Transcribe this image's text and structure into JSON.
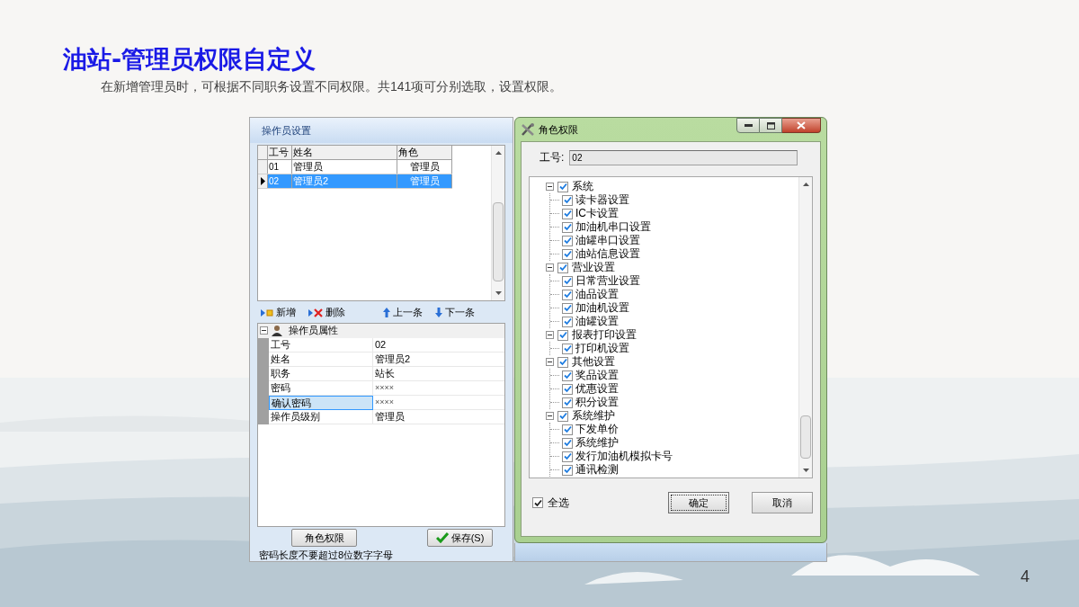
{
  "slide": {
    "title": "油站-管理员权限自定义",
    "subtitle": "在新增管理员时，可根据不同职务设置不同权限。共141项可分别选取，设置权限。",
    "page_number": "4"
  },
  "operator_window": {
    "title": "操作员设置",
    "grid": {
      "columns": [
        "工号",
        "姓名",
        "角色"
      ],
      "rows": [
        {
          "cells": [
            "01",
            "管理员",
            "管理员"
          ],
          "selected": false
        },
        {
          "cells": [
            "02",
            "管理员2",
            "管理员"
          ],
          "selected": true
        }
      ]
    },
    "toolbar": [
      {
        "label": "新增",
        "kind": "add"
      },
      {
        "label": "删除",
        "kind": "delete"
      },
      {
        "label": "上一条",
        "kind": "up"
      },
      {
        "label": "下一条",
        "kind": "down"
      }
    ],
    "properties": {
      "category": "操作员属性",
      "expanded": true,
      "rows": [
        {
          "name": "工号",
          "value": "02",
          "selected": false
        },
        {
          "name": "姓名",
          "value": "管理员2",
          "selected": false
        },
        {
          "name": "职务",
          "value": "站长",
          "selected": false
        },
        {
          "name": "密码",
          "value": "××××",
          "selected": false
        },
        {
          "name": "确认密码",
          "value": "××××",
          "selected": true
        },
        {
          "name": "操作员级别",
          "value": "管理员",
          "selected": false
        }
      ]
    },
    "role_button": "角色权限",
    "save_button": "保存(S)",
    "status": "密码长度不要超过8位数字字母"
  },
  "role_dialog": {
    "title": "角色权限",
    "id_label": "工号:",
    "id_value": "02",
    "tree": [
      {
        "label": "系统",
        "checked": true,
        "expanded": true,
        "children": [
          {
            "label": "读卡器设置",
            "checked": true
          },
          {
            "label": "IC卡设置",
            "checked": true
          },
          {
            "label": "加油机串口设置",
            "checked": true
          },
          {
            "label": "油罐串口设置",
            "checked": true
          },
          {
            "label": "油站信息设置",
            "checked": true
          }
        ]
      },
      {
        "label": "营业设置",
        "checked": true,
        "expanded": true,
        "children": [
          {
            "label": "日常营业设置",
            "checked": true
          },
          {
            "label": "油品设置",
            "checked": true
          },
          {
            "label": "加油机设置",
            "checked": true
          },
          {
            "label": "油罐设置",
            "checked": true
          }
        ]
      },
      {
        "label": "报表打印设置",
        "checked": true,
        "expanded": true,
        "children": [
          {
            "label": "打印机设置",
            "checked": true
          }
        ]
      },
      {
        "label": "其他设置",
        "checked": true,
        "expanded": true,
        "children": [
          {
            "label": "奖品设置",
            "checked": true
          },
          {
            "label": "优惠设置",
            "checked": true
          },
          {
            "label": "积分设置",
            "checked": true
          }
        ]
      },
      {
        "label": "系统维护",
        "checked": true,
        "expanded": true,
        "children": [
          {
            "label": "下发单价",
            "checked": true
          },
          {
            "label": "系统维护",
            "checked": true
          },
          {
            "label": "发行加油机模拟卡号",
            "checked": true
          },
          {
            "label": "通讯检测",
            "checked": true
          }
        ]
      }
    ],
    "select_all": {
      "label": "全选",
      "checked": true
    },
    "ok_button": "确定",
    "cancel_button": "取消"
  }
}
